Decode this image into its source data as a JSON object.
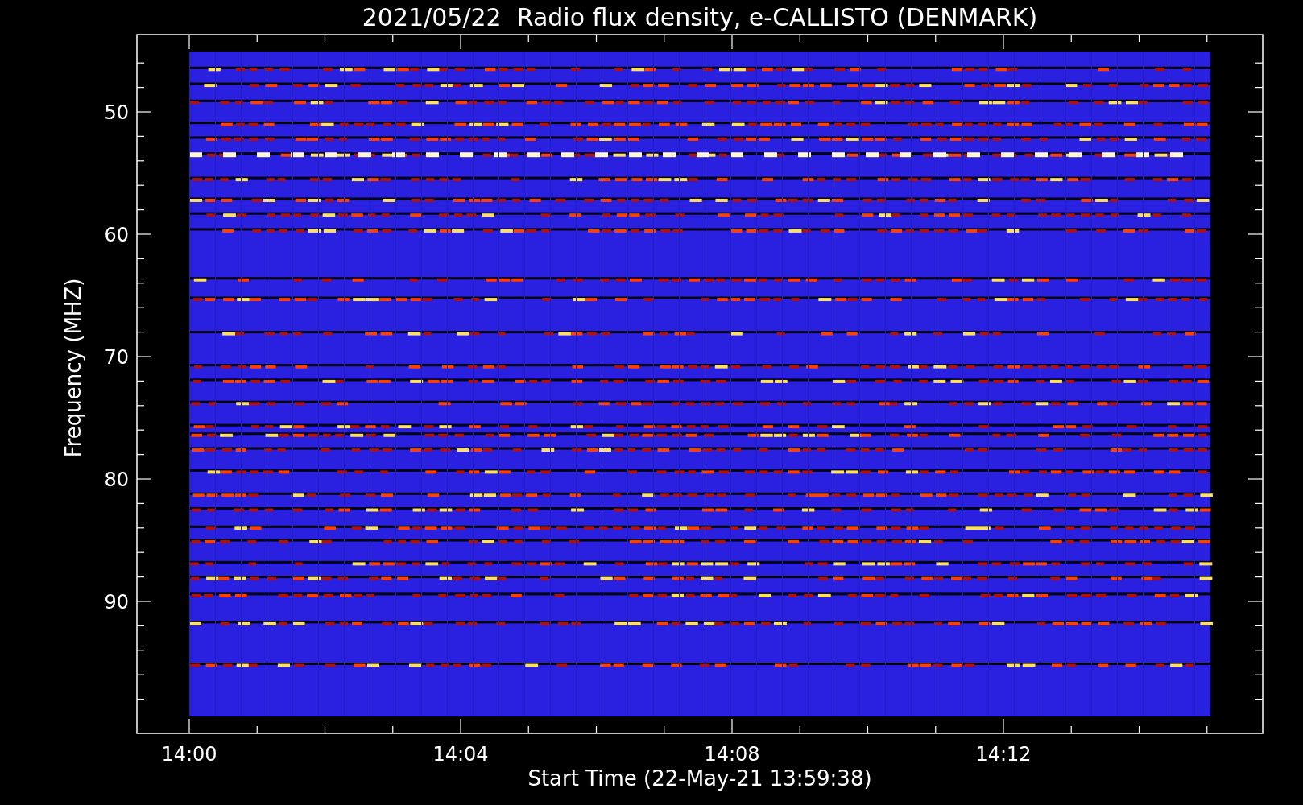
{
  "title": "2021/05/22  Radio flux density, e-CALLISTO (DENMARK)",
  "y_axis": {
    "label": "Frequency (MHZ)",
    "ticks": [
      "50",
      "60",
      "70",
      "80",
      "90"
    ]
  },
  "x_axis": {
    "label": "Start Time (22-May-21 13:59:38)",
    "ticks": [
      "14:00",
      "14:04",
      "14:08",
      "14:12"
    ]
  }
}
